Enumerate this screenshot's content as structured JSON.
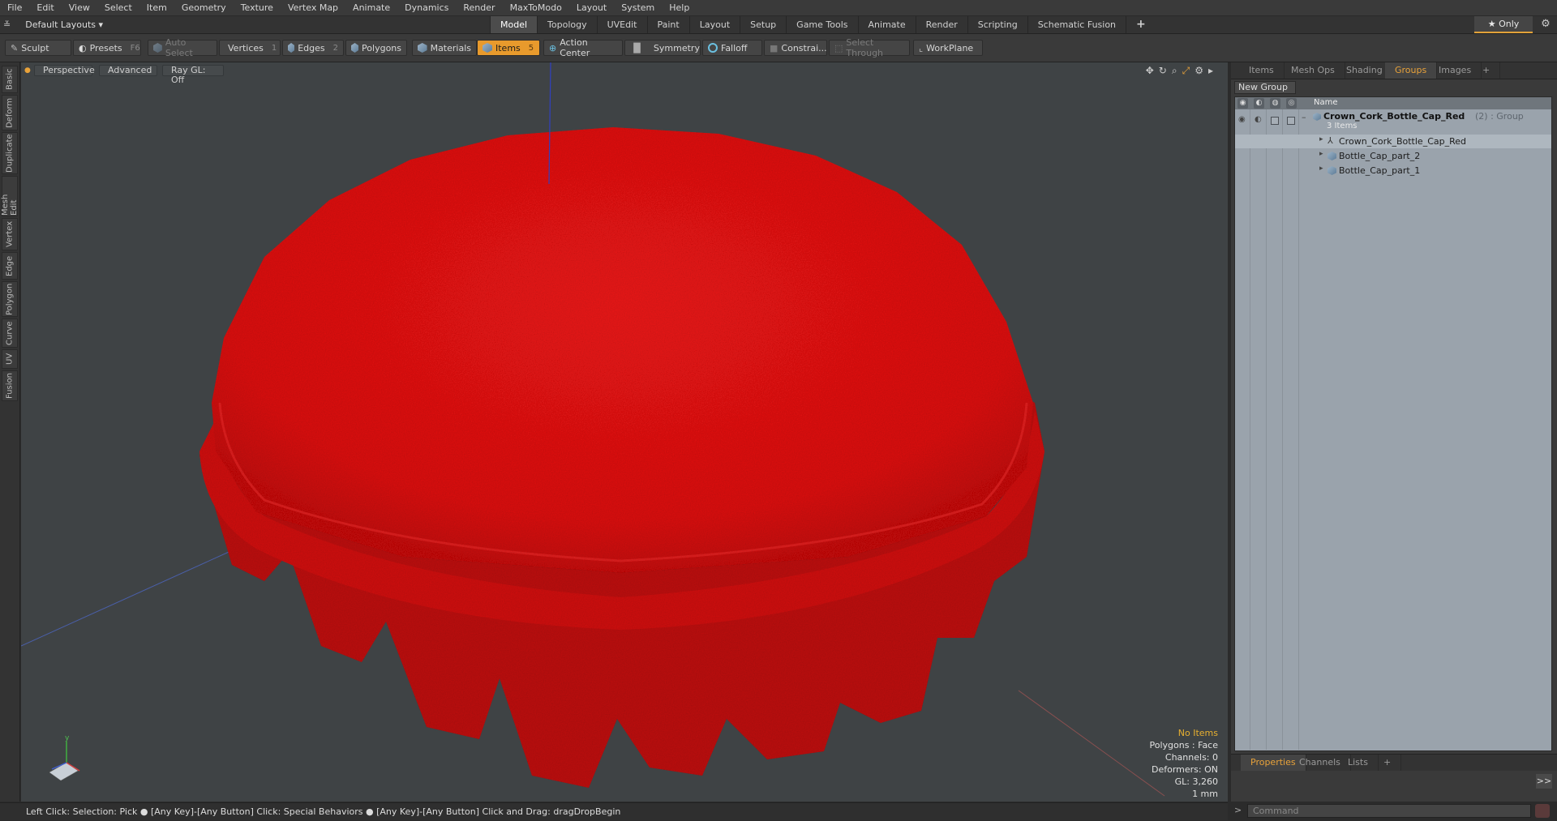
{
  "menu": [
    "File",
    "Edit",
    "View",
    "Select",
    "Item",
    "Geometry",
    "Texture",
    "Vertex Map",
    "Animate",
    "Dynamics",
    "Render",
    "MaxToModo",
    "Layout",
    "System",
    "Help"
  ],
  "layout_selector": "Default Layouts ▾",
  "layout_tabs": [
    "Model",
    "Topology",
    "UVEdit",
    "Paint",
    "Layout",
    "Setup",
    "Game Tools",
    "Animate",
    "Render",
    "Scripting",
    "Schematic Fusion",
    "+"
  ],
  "active_layout_tab": "Model",
  "only_label": "★  Only",
  "toolbar": {
    "sculpt": "Sculpt",
    "presets": "Presets",
    "presets_key": "F6",
    "auto_select": "Auto Select",
    "vertices": "Vertices",
    "vertices_count": "1",
    "edges": "Edges",
    "edges_count": "2",
    "polygons": "Polygons",
    "materials": "Materials",
    "items": "Items",
    "items_count": "5",
    "action_center": "Action Center",
    "symmetry": "Symmetry",
    "falloff": "Falloff",
    "constrain": "Constrai...",
    "select_through": "Select Through",
    "workplane": "WorkPlane"
  },
  "left_tabs": [
    "Basic",
    "Deform",
    "Duplicate",
    "Mesh Edit",
    "Vertex",
    "Edge",
    "Polygon",
    "Curve",
    "UV",
    "Fusion"
  ],
  "viewport": {
    "view": "Perspective",
    "shading": "Advanced",
    "raygl": "Ray GL: Off",
    "info": {
      "items": "No Items",
      "polygons": "Polygons : Face",
      "channels": "Channels: 0",
      "deformers": "Deformers: ON",
      "gl": "GL: 3,260",
      "scale": "1 mm"
    }
  },
  "right_panel": {
    "tabs": [
      "Items",
      "Mesh Ops",
      "Shading",
      "Groups",
      "Images",
      "+"
    ],
    "active_tab": "Groups",
    "new_group": "New Group",
    "column_name": "Name",
    "group": {
      "name": "Crown_Cork_Bottle_Cap_Red",
      "suffix": "(2) : Group",
      "count": "3 Items",
      "children": [
        "Crown_Cork_Bottle_Cap_Red",
        "Bottle_Cap_part_2",
        "Bottle_Cap_part_1"
      ]
    },
    "bottom_tabs": [
      "Properties",
      "Channels",
      "Lists",
      "+"
    ],
    "arrow": ">>"
  },
  "status": "Left Click: Selection: Pick ●  [Any Key]-[Any Button] Click: Special Behaviors ●  [Any Key]-[Any Button] Click and Drag: dragDropBegin",
  "command_placeholder": "Command",
  "colors": {
    "accent": "#e89a2c",
    "cap_red": "#e81212"
  }
}
